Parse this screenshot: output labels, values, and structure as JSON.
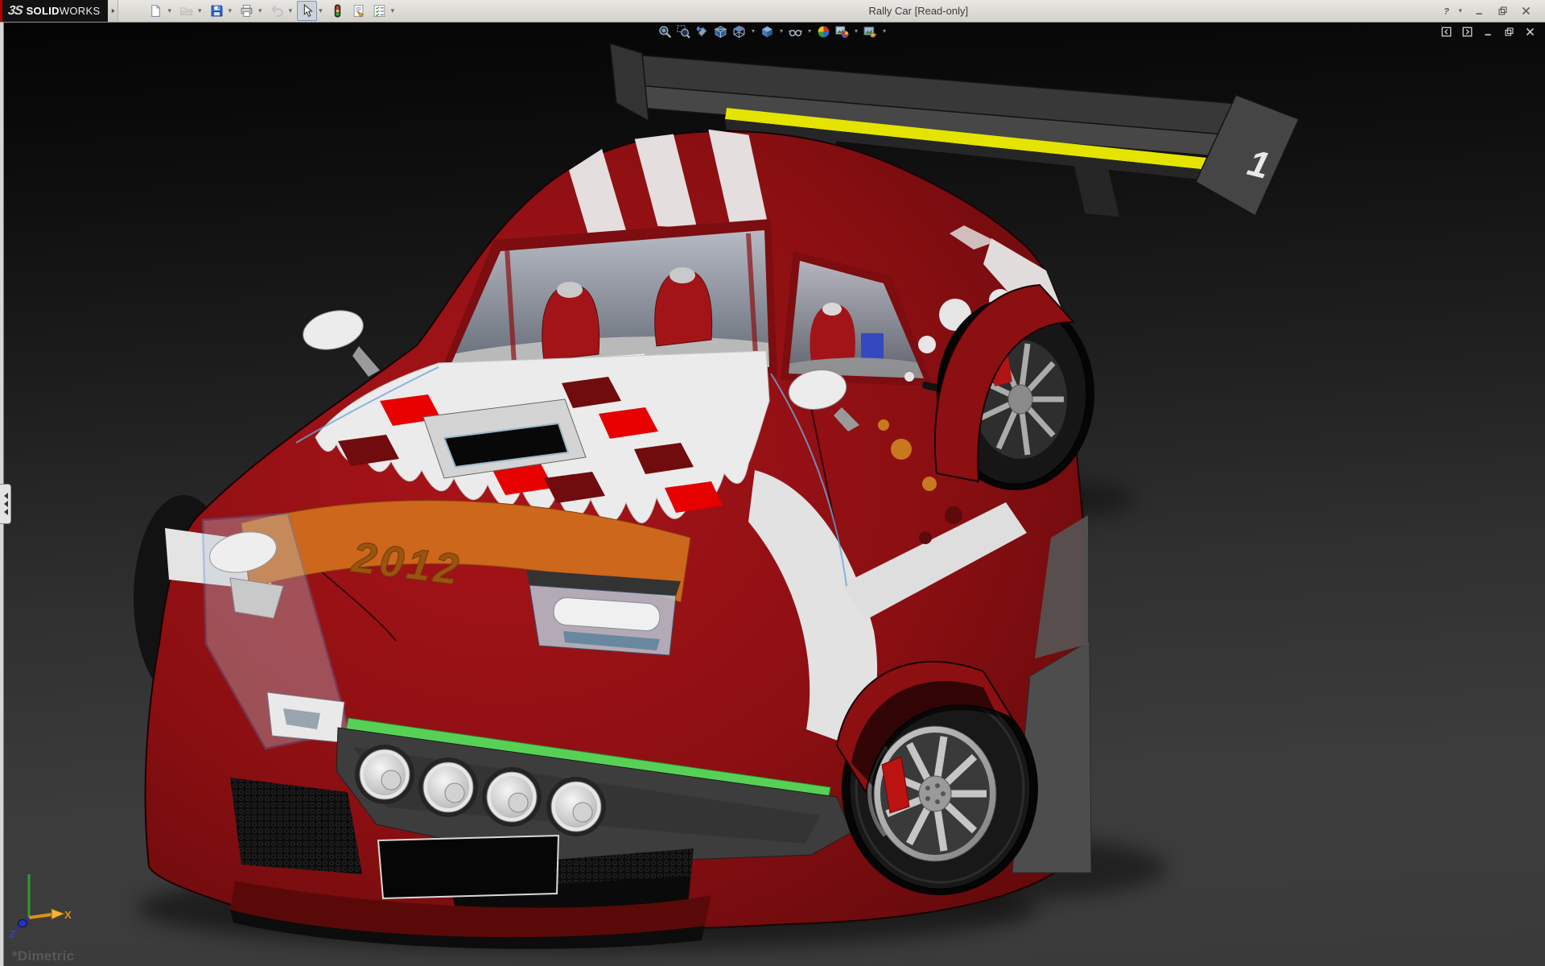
{
  "window": {
    "title": "Rally Car [Read-only]",
    "brand": {
      "mark": "3S",
      "name_bold": "SOLID",
      "name_light": "WORKS"
    }
  },
  "menubar": {
    "buttons": [
      {
        "icon": "new-document",
        "dropdown": true
      },
      {
        "icon": "open-folder",
        "dropdown": true,
        "disabled": true
      },
      {
        "icon": "save",
        "dropdown": true
      },
      {
        "icon": "print",
        "dropdown": true
      },
      {
        "icon": "undo",
        "dropdown": true,
        "disabled": true
      },
      {
        "icon": "select-cursor",
        "dropdown": true,
        "pressed": true
      },
      {
        "icon": "rebuild-traffic-light"
      },
      {
        "icon": "file-properties"
      },
      {
        "icon": "options-checklist",
        "dropdown": true
      }
    ],
    "window_buttons": [
      {
        "icon": "help-question",
        "dropdown": true
      },
      {
        "icon": "minimize"
      },
      {
        "icon": "restore"
      },
      {
        "icon": "close"
      }
    ]
  },
  "headsup": {
    "buttons": [
      {
        "icon": "zoom-to-fit"
      },
      {
        "icon": "zoom-to-area"
      },
      {
        "icon": "previous-view"
      },
      {
        "icon": "section-view"
      },
      {
        "icon": "view-orientation",
        "dropdown": true
      },
      {
        "icon": "display-style",
        "dropdown": true
      },
      {
        "icon": "hide-show-items",
        "dropdown": true
      },
      {
        "icon": "edit-appearance"
      },
      {
        "icon": "apply-scene",
        "dropdown": true
      },
      {
        "icon": "view-settings",
        "dropdown": true
      }
    ]
  },
  "doc_controls": [
    {
      "icon": "pane-left"
    },
    {
      "icon": "pane-right"
    },
    {
      "icon": "minimize"
    },
    {
      "icon": "restore"
    },
    {
      "icon": "close"
    }
  ],
  "viewport": {
    "view_label": "*Dimetric",
    "triad": {
      "x_label": "X",
      "z_label": "Z"
    }
  },
  "model": {
    "year_decal": "2012",
    "wing_number": "1"
  },
  "colors": {
    "body_red": "#8c0f12",
    "wing_stripe_yellow": "#e4e400",
    "decal_orange": "#cd671b",
    "grille_accent_green": "#56d156"
  }
}
